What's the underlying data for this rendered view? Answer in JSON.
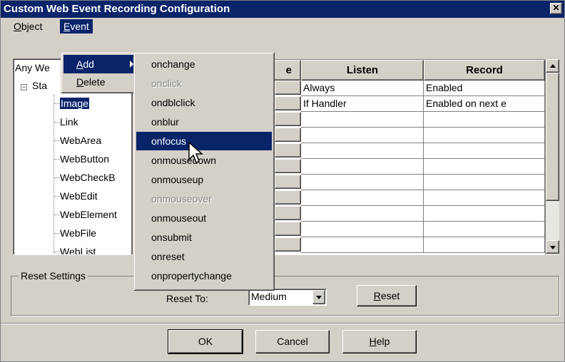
{
  "window": {
    "title": "Custom Web Event Recording Configuration",
    "close_glyph": "✕"
  },
  "menubar": {
    "object": {
      "accel": "O",
      "rest": "bject"
    },
    "event": {
      "accel": "E",
      "rest": "vent"
    }
  },
  "event_menu": {
    "add": {
      "accel": "A",
      "rest": "dd"
    },
    "delete": {
      "accel": "D",
      "rest": "elete"
    }
  },
  "add_submenu": {
    "items": [
      {
        "label": "onchange",
        "state": "normal"
      },
      {
        "label": "onclick",
        "state": "disabled"
      },
      {
        "label": "ondblclick",
        "state": "normal"
      },
      {
        "label": "onblur",
        "state": "normal"
      },
      {
        "label": "onfocus",
        "state": "selected"
      },
      {
        "label": "onmousedown",
        "state": "normal"
      },
      {
        "label": "onmouseup",
        "state": "normal"
      },
      {
        "label": "onmouseover",
        "state": "disabled"
      },
      {
        "label": "onmouseout",
        "state": "normal"
      },
      {
        "label": "onsubmit",
        "state": "normal"
      },
      {
        "label": "onreset",
        "state": "normal"
      },
      {
        "label": "onpropertychange",
        "state": "normal"
      }
    ]
  },
  "tree": {
    "root": "Any We",
    "standard": "Sta",
    "items": [
      "Image",
      "Link",
      "WebArea",
      "WebButton",
      "WebCheckB",
      "WebEdit",
      "WebElement",
      "WebFile",
      "WebList"
    ],
    "selected": "Image"
  },
  "grid": {
    "headers": {
      "name_partial": "e",
      "listen": "Listen",
      "record": "Record"
    },
    "rows": [
      {
        "listen": "Always",
        "record": "Enabled"
      },
      {
        "listen": "If Handler",
        "record": "Enabled on next e"
      },
      {
        "listen": "",
        "record": ""
      },
      {
        "listen": "",
        "record": ""
      },
      {
        "listen": "",
        "record": ""
      },
      {
        "listen": "",
        "record": ""
      },
      {
        "listen": "",
        "record": ""
      },
      {
        "listen": "",
        "record": ""
      },
      {
        "listen": "",
        "record": ""
      },
      {
        "listen": "",
        "record": ""
      },
      {
        "listen": "",
        "record": ""
      }
    ]
  },
  "reset_settings": {
    "title": "Reset Settings",
    "reset_to_label": "Reset To:",
    "level_value": "Medium",
    "reset_button": {
      "accel": "R",
      "rest": "eset"
    }
  },
  "footer": {
    "ok": "OK",
    "cancel": "Cancel",
    "help": {
      "accel": "H",
      "rest": "elp"
    }
  },
  "colors": {
    "face": "#d4d0c8",
    "selection": "#0a246a",
    "titlebar": "#0a246a"
  }
}
